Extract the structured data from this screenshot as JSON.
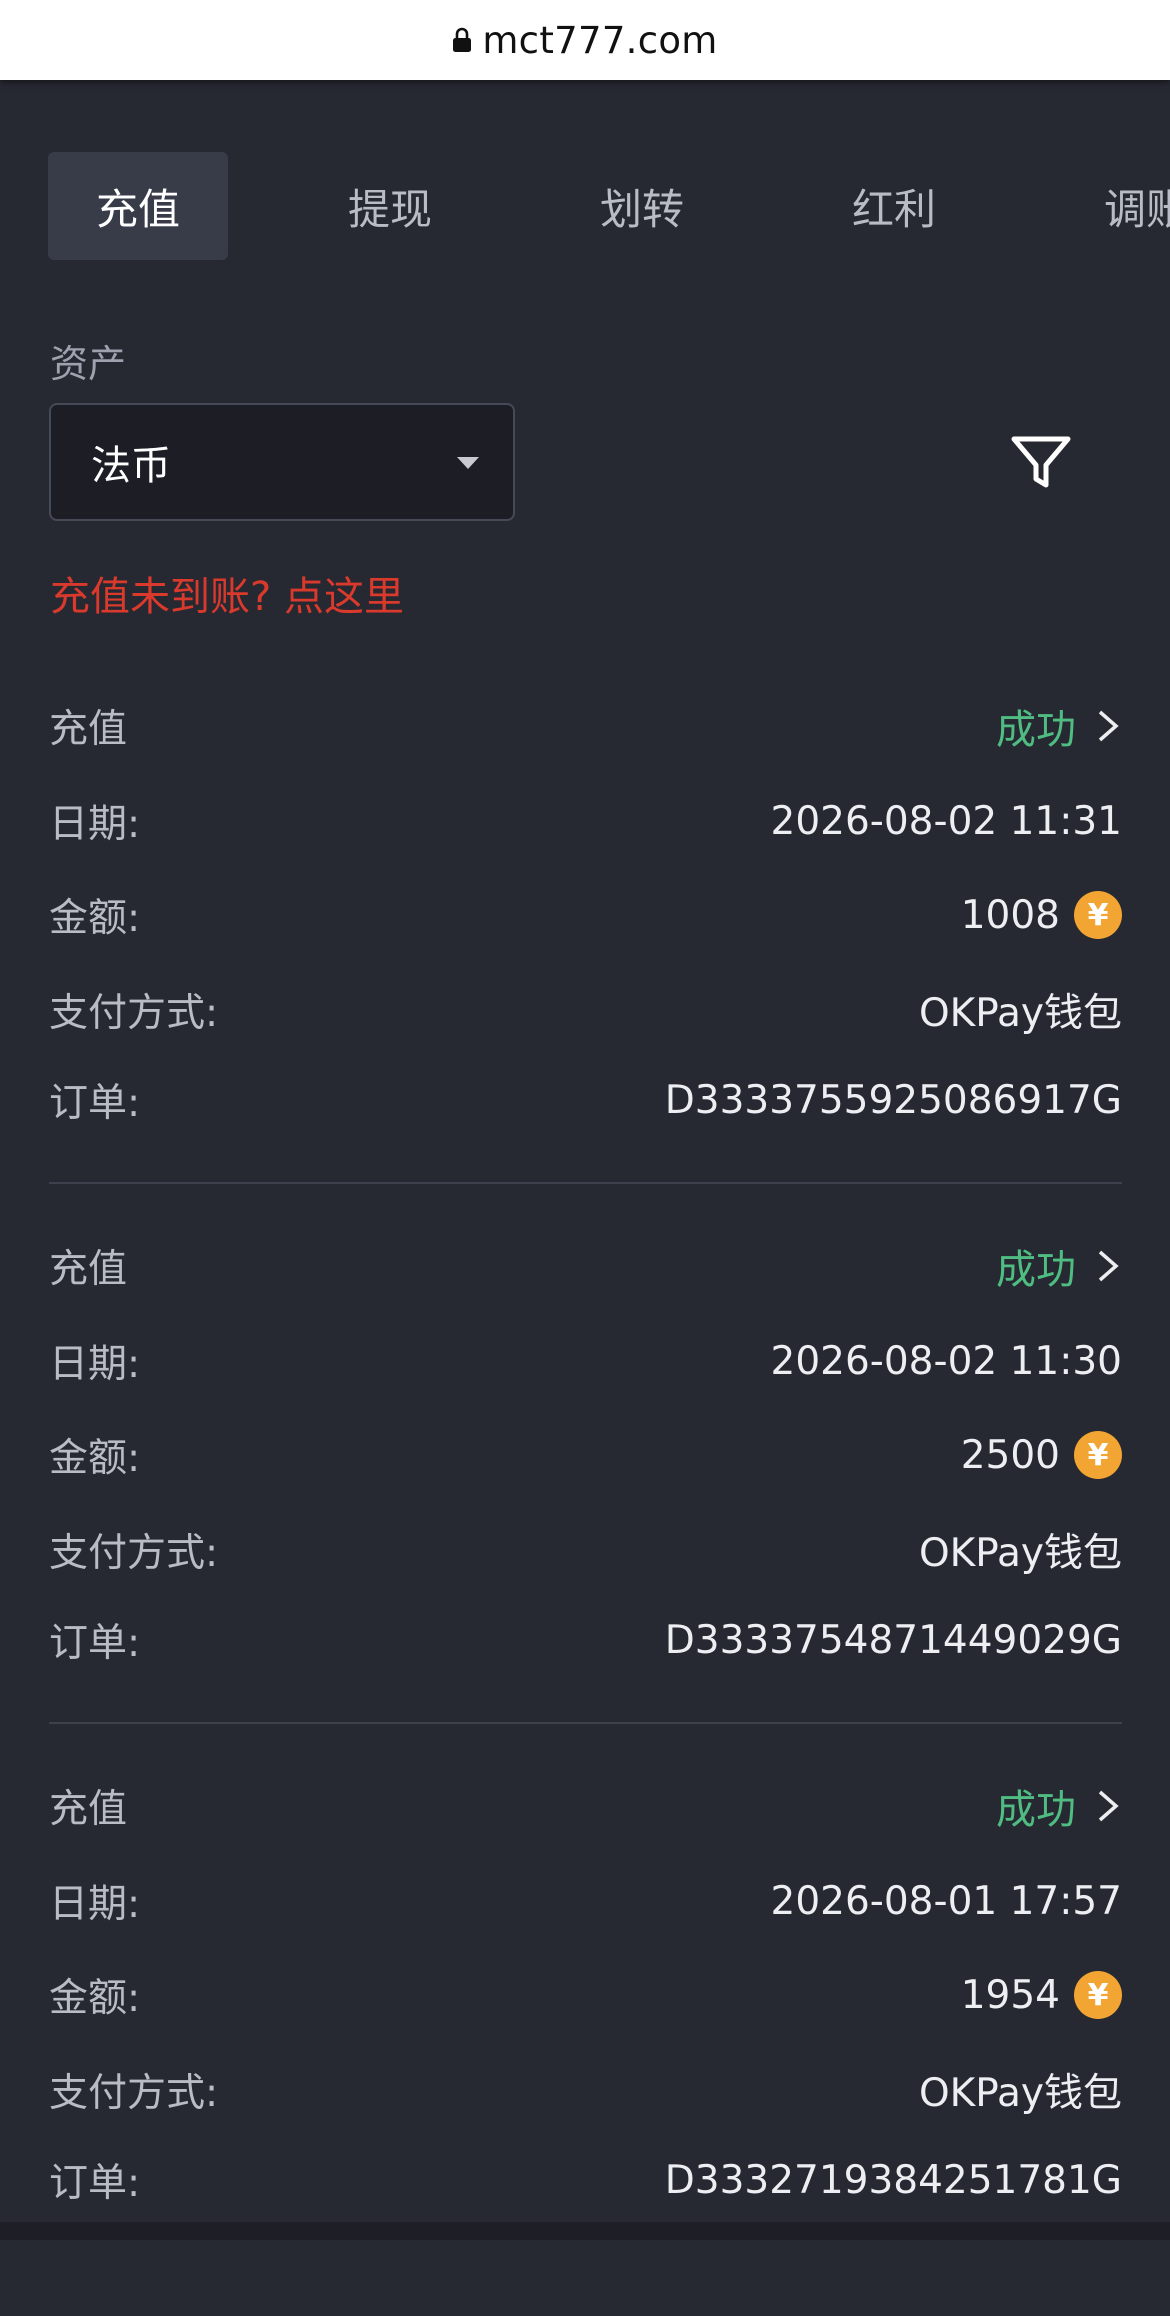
{
  "browser": {
    "url": "mct777.com"
  },
  "tabs": [
    {
      "label": "充值",
      "active": true
    },
    {
      "label": "提现",
      "active": false
    },
    {
      "label": "划转",
      "active": false
    },
    {
      "label": "红利",
      "active": false
    },
    {
      "label": "调账",
      "active": false
    }
  ],
  "filters": {
    "asset_label": "资产",
    "asset_value": "法币",
    "filter_icon": "filter-funnel-icon"
  },
  "help_link": "充值未到账? 点这里",
  "labels": {
    "date": "日期:",
    "amount": "金额:",
    "method": "支付方式:",
    "order": "订单:"
  },
  "colors": {
    "background": "#262832",
    "success": "#4fbd82",
    "link_red": "#d93a2c",
    "coin": "#f2a532"
  },
  "records": [
    {
      "type": "充值",
      "status": "成功",
      "date": "2026-08-02 11:31",
      "amount": "1008",
      "currency_symbol": "¥",
      "method": "OKPay钱包",
      "order": "D3333755925086917G"
    },
    {
      "type": "充值",
      "status": "成功",
      "date": "2026-08-02 11:30",
      "amount": "2500",
      "currency_symbol": "¥",
      "method": "OKPay钱包",
      "order": "D3333754871449029G"
    },
    {
      "type": "充值",
      "status": "成功",
      "date": "2026-08-01 17:57",
      "amount": "1954",
      "currency_symbol": "¥",
      "method": "OKPay钱包",
      "order": "D3332719384251781G"
    }
  ]
}
